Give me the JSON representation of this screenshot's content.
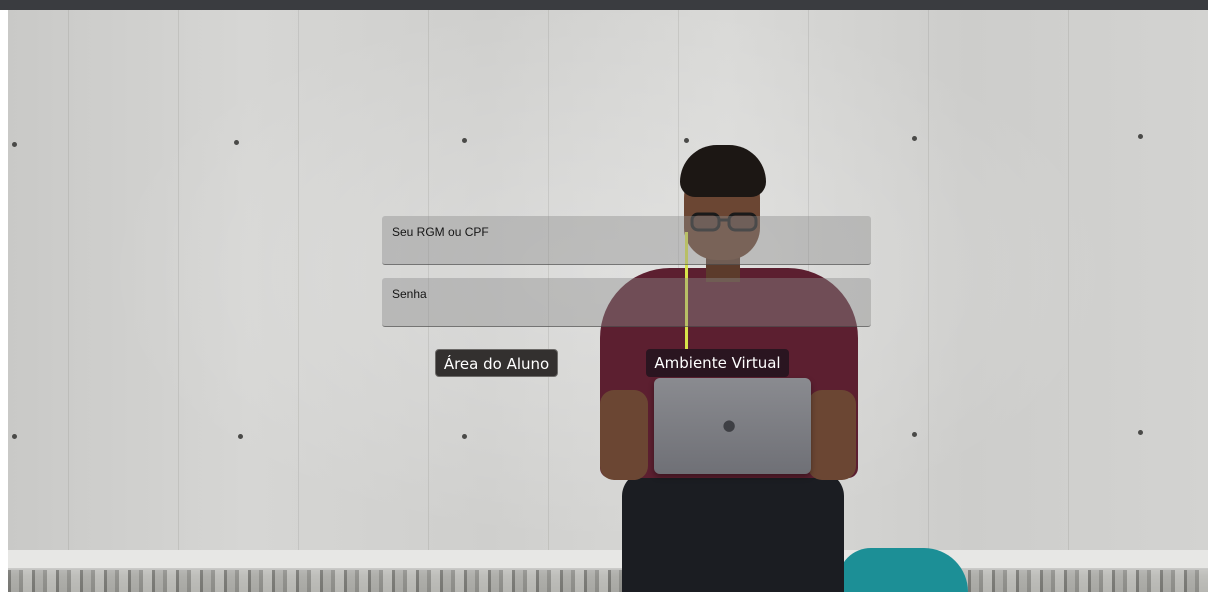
{
  "login_form": {
    "rgm_placeholder": "Seu RGM ou CPF",
    "password_placeholder": "Senha",
    "rgm_value": "",
    "password_value": ""
  },
  "actions": {
    "student_area_label": "Área do Aluno",
    "virtual_environment_label": "Ambiente Virtual"
  },
  "background": {
    "icon": "student-with-laptop-photo",
    "wall_color": "#d2d2d0",
    "button_dark_color": "#33302f"
  }
}
